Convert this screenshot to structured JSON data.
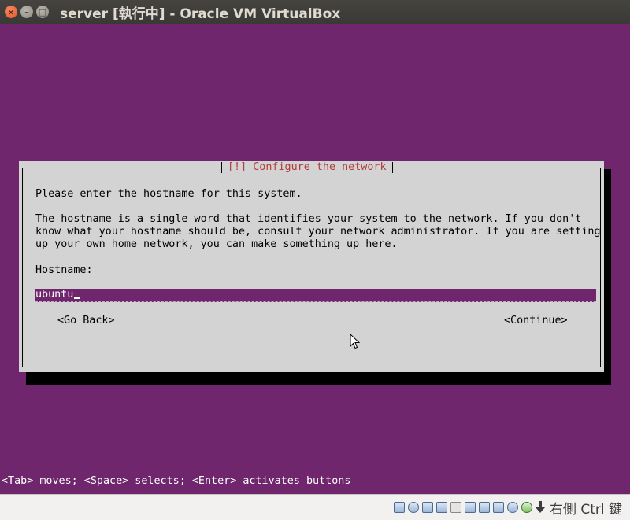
{
  "window": {
    "title": "server [執行中] - Oracle VM VirtualBox",
    "close_glyph": "×",
    "minimize_glyph": "–",
    "maximize_glyph": "□"
  },
  "dialog": {
    "title": "[!] Configure the network",
    "prompt": "Please enter the hostname for this system.",
    "description_lines": [
      "The hostname is a single word that identifies your system to the network. If you don't",
      "know what your hostname should be, consult your network administrator. If you are setting",
      "up your own home network, you can make something up here."
    ],
    "field_label": "Hostname:",
    "hostname_value": "ubuntu",
    "go_back_label": "<Go Back>",
    "continue_label": "<Continue>"
  },
  "hint": "<Tab> moves; <Space> selects; <Enter> activates buttons",
  "statusbar": {
    "icons": [
      "hard-disk-icon",
      "optical-drive-icon",
      "usb-icon",
      "shared-folders-icon",
      "display-icon",
      "screen-capture-icon",
      "network-icon",
      "video-capture-icon",
      "mouse-integration-icon",
      "download-arrow-icon"
    ],
    "host_key": "右側 Ctrl 鍵"
  },
  "colors": {
    "guest_background": "#6f266d",
    "dialog_background": "#d3d3d3",
    "dialog_title": "#b53a3a"
  }
}
